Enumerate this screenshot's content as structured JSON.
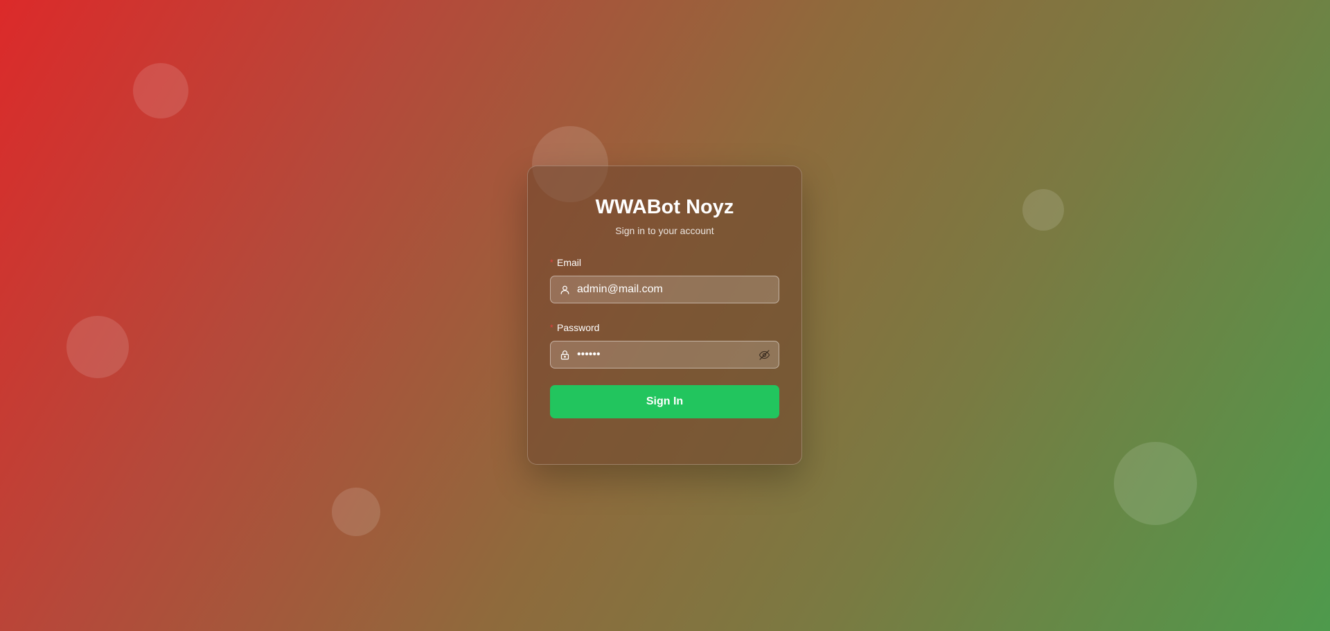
{
  "app": {
    "title": "WWABot Noyz",
    "subtitle": "Sign in to your account"
  },
  "form": {
    "email": {
      "label": "Email",
      "required_mark": "*",
      "value": "admin@mail.com",
      "icon": "user-icon"
    },
    "password": {
      "label": "Password",
      "required_mark": "*",
      "value": "123456",
      "icon": "lock-icon",
      "toggle_icon": "eye-off-icon"
    },
    "submit_label": "Sign In"
  },
  "colors": {
    "accent": "#22c55e",
    "required": "#e04040",
    "gradient_start": "#dc2a2a",
    "gradient_end": "#4e9a4c"
  }
}
